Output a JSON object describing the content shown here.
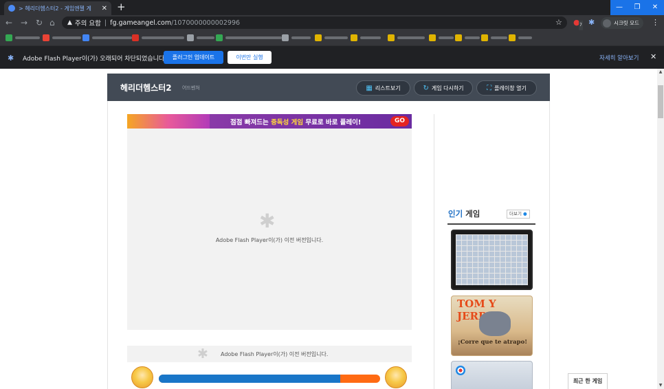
{
  "browser": {
    "tab_title": "> 헤리더헴스터2 - 게임엔젤 게",
    "tab_close": "✕",
    "new_tab": "+",
    "window_controls": [
      "—",
      "❐",
      "✕"
    ],
    "url_warning": "주의 요함",
    "url_host": "fg.gameangel.com",
    "url_path": "/1070000000002996",
    "incognito_label": "시크릿 모드",
    "extension_badge": "7"
  },
  "infobar": {
    "message": "Adobe Flash Player이(가) 오래되어 차단되었습니다",
    "update_button": "플러그인 업데이트",
    "run_once_button": "이번만 실행",
    "learn_more": "자세히 알아보기",
    "close": "✕"
  },
  "game_header": {
    "title": "헤리더헴스터2",
    "subtitle": "어드벤처",
    "list_button": "리스트보기",
    "replay_button": "게임 다시하기",
    "popup_button": "플레이창 열기"
  },
  "banner": {
    "text_pre": "점점 빠져드는 ",
    "text_highlight": "중독성 게임",
    "text_post": " 무료로 바로 플레이!",
    "go": "GO"
  },
  "flash": {
    "message_main": "Adobe Flash Player이(가) 이전 버전입니다.",
    "message_strip": "Adobe Flash Player이(가) 이전 버전입니다."
  },
  "progress": {
    "value": 0.82,
    "fill_color": "#1976c8",
    "rest_color": "#ff6a13"
  },
  "sidebar": {
    "popular_title_hl": "인기",
    "popular_title_rest": " 게임",
    "more_button": "더보기",
    "thumbnails": [
      {
        "logo": "",
        "caption": ""
      },
      {
        "logo": "TOM Y JERRY",
        "caption": "¡Corre que te atrapo!"
      },
      {
        "logo": "",
        "caption": ""
      }
    ]
  },
  "recent_button": "최근 한 게임",
  "colors": {
    "accent": "#1a73e8",
    "header_bg": "#424a55",
    "popular_accent": "#1e6fc4"
  }
}
